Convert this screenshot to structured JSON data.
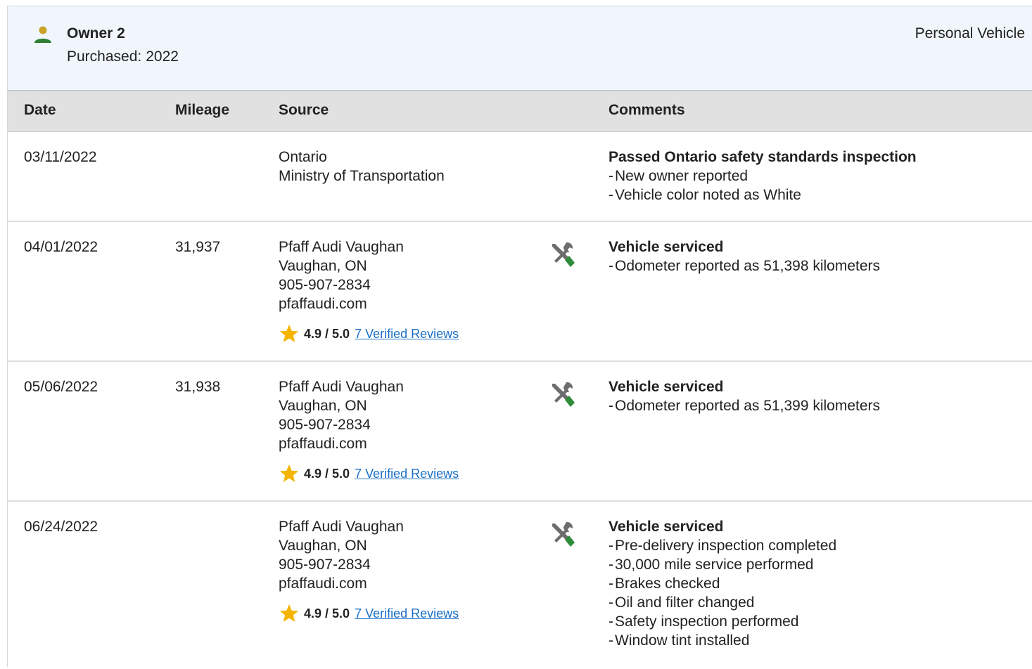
{
  "owner": {
    "title": "Owner 2",
    "purchased_label": "Purchased:",
    "purchased_year": "2022",
    "vehicle_type": "Personal Vehicle",
    "icon": "person-icon",
    "icon_color": "#2e7d32"
  },
  "table": {
    "headers": {
      "date": "Date",
      "mileage": "Mileage",
      "source": "Source",
      "comments": "Comments"
    },
    "rows": [
      {
        "date": "03/11/2022",
        "mileage": "",
        "source": {
          "line1": "Ontario",
          "line2": "Ministry of Transportation"
        },
        "comment_title": "Passed Ontario safety standards inspection",
        "comments": [
          "New owner reported",
          "Vehicle color noted as White"
        ]
      },
      {
        "date": "04/01/2022",
        "mileage": "31,937",
        "source": {
          "line1": "Pfaff Audi Vaughan",
          "line2": "Vaughan, ON",
          "line3": "905-907-2834",
          "line4": "pfaffaudi.com",
          "rating": "4.9 / 5.0",
          "reviews": "7 Verified Reviews"
        },
        "icon": "service-tools-icon",
        "comment_title": "Vehicle serviced",
        "comments": [
          "Odometer reported as 51,398 kilometers"
        ]
      },
      {
        "date": "05/06/2022",
        "mileage": "31,938",
        "source": {
          "line1": "Pfaff Audi Vaughan",
          "line2": "Vaughan, ON",
          "line3": "905-907-2834",
          "line4": "pfaffaudi.com",
          "rating": "4.9 / 5.0",
          "reviews": "7 Verified Reviews"
        },
        "icon": "service-tools-icon",
        "comment_title": "Vehicle serviced",
        "comments": [
          "Odometer reported as 51,399 kilometers"
        ]
      },
      {
        "date": "06/24/2022",
        "mileage": "",
        "source": {
          "line1": "Pfaff Audi Vaughan",
          "line2": "Vaughan, ON",
          "line3": "905-907-2834",
          "line4": "pfaffaudi.com",
          "rating": "4.9 / 5.0",
          "reviews": "7 Verified Reviews"
        },
        "icon": "service-tools-icon",
        "comment_title": "Vehicle serviced",
        "comments": [
          "Pre-delivery inspection completed",
          "30,000 mile service performed",
          "Brakes checked",
          "Oil and filter changed",
          "Safety inspection performed",
          "Window tint installed"
        ]
      }
    ]
  },
  "bullet_dash": "-",
  "colors": {
    "header_bg": "#f0f6fc",
    "table_head_bg": "#e1e1e1",
    "link": "#1a6fc6",
    "star": "#f5b400",
    "tool_gray": "#6d6d6d",
    "tool_green": "#2e8b3a"
  }
}
